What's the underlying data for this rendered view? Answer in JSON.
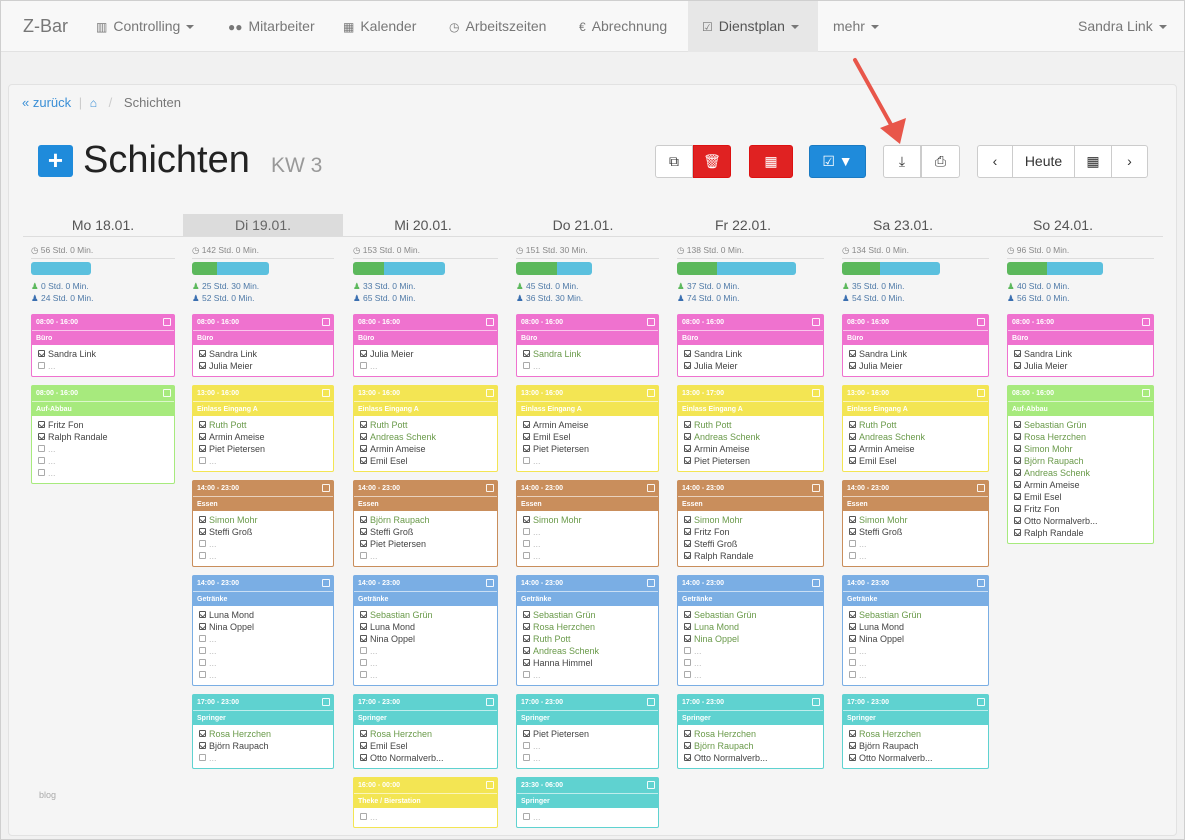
{
  "nav": {
    "brand": "Z-Bar",
    "items": [
      {
        "label": "Controlling",
        "icon": "bar-chart-icon"
      },
      {
        "label": "Mitarbeiter",
        "icon": "users-icon"
      },
      {
        "label": "Kalender",
        "icon": "calendar-icon"
      },
      {
        "label": "Arbeitszeiten",
        "icon": "clock-icon"
      },
      {
        "label": "Abrechnung",
        "icon": "euro-icon"
      },
      {
        "label": "Dienstplan",
        "icon": "calendar-check-icon"
      },
      {
        "label": "mehr",
        "icon": ""
      }
    ],
    "user": "Sandra Link"
  },
  "breadcrumb": {
    "back": "« zurück",
    "current": "Schichten"
  },
  "page": {
    "title": "Schichten",
    "week": "KW 3"
  },
  "toolbar": {
    "today": "Heute"
  },
  "footer": {
    "text": "blog"
  },
  "days": [
    {
      "label": "Mo 18.01.",
      "total": "56 Std. 0 Min.",
      "a": "0 Std. 0 Min.",
      "b": "24 Std. 0 Min.",
      "green": 0,
      "blue": 62,
      "cards": [
        {
          "time": "08:00 - 16:00",
          "name": "Büro",
          "color": "#ef72cf",
          "rows": [
            {
              "n": "Sandra Link",
              "c": 1
            },
            {
              "n": "...",
              "c": 0
            }
          ]
        },
        {
          "time": "08:00 - 16:00",
          "name": "Auf-Abbau",
          "color": "#a7ea7d",
          "rows": [
            {
              "n": "Fritz Fon",
              "c": 1
            },
            {
              "n": "Ralph Randale",
              "c": 1
            },
            {
              "n": "...",
              "c": 0
            },
            {
              "n": "...",
              "c": 0
            },
            {
              "n": "...",
              "c": 0
            }
          ]
        }
      ]
    },
    {
      "label": "Di 19.01.",
      "total": "142 Std. 0 Min.",
      "a": "25 Std. 30 Min.",
      "b": "52 Std. 0 Min.",
      "green": 26,
      "blue": 54,
      "cards": [
        {
          "time": "08:00 - 16:00",
          "name": "Büro",
          "color": "#ef72cf",
          "rows": [
            {
              "n": "Sandra Link",
              "c": 1
            },
            {
              "n": "Julia Meier",
              "c": 1
            }
          ]
        },
        {
          "time": "13:00 - 16:00",
          "name": "Einlass Eingang A",
          "color": "#f3e553",
          "rows": [
            {
              "n": "Ruth Pott",
              "c": 1,
              "g": 1
            },
            {
              "n": "Armin Ameise",
              "c": 1
            },
            {
              "n": "Piet Pietersen",
              "c": 1
            },
            {
              "n": "...",
              "c": 0
            }
          ]
        },
        {
          "time": "14:00 - 23:00",
          "name": "Essen",
          "color": "#c98e5c",
          "rows": [
            {
              "n": "Simon Mohr",
              "c": 1,
              "g": 1
            },
            {
              "n": "Steffi Groß",
              "c": 1
            },
            {
              "n": "...",
              "c": 0
            },
            {
              "n": "...",
              "c": 0
            }
          ]
        },
        {
          "time": "14:00 - 23:00",
          "name": "Getränke",
          "color": "#7aaee4",
          "rows": [
            {
              "n": "Luna Mond",
              "c": 1
            },
            {
              "n": "Nina Oppel",
              "c": 1
            },
            {
              "n": "...",
              "c": 0
            },
            {
              "n": "...",
              "c": 0
            },
            {
              "n": "...",
              "c": 0
            },
            {
              "n": "...",
              "c": 0
            }
          ]
        },
        {
          "time": "17:00 - 23:00",
          "name": "Springer",
          "color": "#5fd2d0",
          "rows": [
            {
              "n": "Rosa Herzchen",
              "c": 1,
              "g": 1
            },
            {
              "n": "Björn Raupach",
              "c": 1
            },
            {
              "n": "...",
              "c": 0
            }
          ]
        }
      ]
    },
    {
      "label": "Mi 20.01.",
      "total": "153 Std. 0 Min.",
      "a": "33 Std. 0 Min.",
      "b": "65 Std. 0 Min.",
      "green": 32,
      "blue": 62,
      "cards": [
        {
          "time": "08:00 - 16:00",
          "name": "Büro",
          "color": "#ef72cf",
          "rows": [
            {
              "n": "Julia Meier",
              "c": 1
            },
            {
              "n": "...",
              "c": 0
            }
          ]
        },
        {
          "time": "13:00 - 16:00",
          "name": "Einlass Eingang A",
          "color": "#f3e553",
          "rows": [
            {
              "n": "Ruth Pott",
              "c": 1,
              "g": 1
            },
            {
              "n": "Andreas Schenk",
              "c": 1,
              "g": 1
            },
            {
              "n": "Armin Ameise",
              "c": 1
            },
            {
              "n": "Emil Esel",
              "c": 1
            }
          ]
        },
        {
          "time": "14:00 - 23:00",
          "name": "Essen",
          "color": "#c98e5c",
          "rows": [
            {
              "n": "Björn Raupach",
              "c": 1,
              "g": 1
            },
            {
              "n": "Steffi Groß",
              "c": 1
            },
            {
              "n": "Piet Pietersen",
              "c": 1
            },
            {
              "n": "...",
              "c": 0
            }
          ]
        },
        {
          "time": "14:00 - 23:00",
          "name": "Getränke",
          "color": "#7aaee4",
          "rows": [
            {
              "n": "Sebastian Grün",
              "c": 1,
              "g": 1
            },
            {
              "n": "Luna Mond",
              "c": 1
            },
            {
              "n": "Nina Oppel",
              "c": 1
            },
            {
              "n": "...",
              "c": 0
            },
            {
              "n": "...",
              "c": 0
            },
            {
              "n": "...",
              "c": 0
            }
          ]
        },
        {
          "time": "17:00 - 23:00",
          "name": "Springer",
          "color": "#5fd2d0",
          "rows": [
            {
              "n": "Rosa Herzchen",
              "c": 1,
              "g": 1
            },
            {
              "n": "Emil Esel",
              "c": 1
            },
            {
              "n": "Otto Normalverb...",
              "c": 1
            }
          ]
        },
        {
          "time": "16:00 - 00:00",
          "name": "Theke / Bierstation",
          "color": "#f3e553",
          "rows": [
            {
              "n": "...",
              "c": 0
            }
          ]
        }
      ]
    },
    {
      "label": "Do 21.01.",
      "total": "151 Std. 30 Min.",
      "a": "45 Std. 0 Min.",
      "b": "36 Std. 30 Min.",
      "green": 42,
      "blue": 36,
      "cards": [
        {
          "time": "08:00 - 16:00",
          "name": "Büro",
          "color": "#ef72cf",
          "rows": [
            {
              "n": "Sandra Link",
              "c": 1,
              "g": 1
            },
            {
              "n": "...",
              "c": 0
            }
          ]
        },
        {
          "time": "13:00 - 16:00",
          "name": "Einlass Eingang A",
          "color": "#f3e553",
          "rows": [
            {
              "n": "Armin Ameise",
              "c": 1
            },
            {
              "n": "Emil Esel",
              "c": 1
            },
            {
              "n": "Piet Pietersen",
              "c": 1
            },
            {
              "n": "...",
              "c": 0
            }
          ]
        },
        {
          "time": "14:00 - 23:00",
          "name": "Essen",
          "color": "#c98e5c",
          "rows": [
            {
              "n": "Simon Mohr",
              "c": 1,
              "g": 1
            },
            {
              "n": "...",
              "c": 0
            },
            {
              "n": "...",
              "c": 0
            },
            {
              "n": "...",
              "c": 0
            }
          ]
        },
        {
          "time": "14:00 - 23:00",
          "name": "Getränke",
          "color": "#7aaee4",
          "rows": [
            {
              "n": "Sebastian Grün",
              "c": 1,
              "g": 1
            },
            {
              "n": "Rosa Herzchen",
              "c": 1,
              "g": 1
            },
            {
              "n": "Ruth Pott",
              "c": 1,
              "g": 1
            },
            {
              "n": "Andreas Schenk",
              "c": 1,
              "g": 1
            },
            {
              "n": "Hanna Himmel",
              "c": 1
            },
            {
              "n": "...",
              "c": 0
            }
          ]
        },
        {
          "time": "17:00 - 23:00",
          "name": "Springer",
          "color": "#5fd2d0",
          "rows": [
            {
              "n": "Piet Pietersen",
              "c": 1
            },
            {
              "n": "...",
              "c": 0
            },
            {
              "n": "...",
              "c": 0
            }
          ]
        },
        {
          "time": "23:30 - 06:00",
          "name": "Springer",
          "color": "#5fd2d0",
          "rows": [
            {
              "n": "...",
              "c": 0
            }
          ]
        }
      ]
    },
    {
      "label": "Fr 22.01.",
      "total": "138 Std. 0 Min.",
      "a": "37 Std. 0 Min.",
      "b": "74 Std. 0 Min.",
      "green": 40,
      "blue": 80,
      "cards": [
        {
          "time": "08:00 - 16:00",
          "name": "Büro",
          "color": "#ef72cf",
          "rows": [
            {
              "n": "Sandra Link",
              "c": 1
            },
            {
              "n": "Julia Meier",
              "c": 1
            }
          ]
        },
        {
          "time": "13:00 - 17:00",
          "name": "Einlass Eingang A",
          "color": "#f3e553",
          "rows": [
            {
              "n": "Ruth Pott",
              "c": 1,
              "g": 1
            },
            {
              "n": "Andreas Schenk",
              "c": 1,
              "g": 1
            },
            {
              "n": "Armin Ameise",
              "c": 1
            },
            {
              "n": "Piet Pietersen",
              "c": 1
            }
          ]
        },
        {
          "time": "14:00 - 23:00",
          "name": "Essen",
          "color": "#c98e5c",
          "rows": [
            {
              "n": "Simon Mohr",
              "c": 1,
              "g": 1
            },
            {
              "n": "Fritz Fon",
              "c": 1
            },
            {
              "n": "Steffi Groß",
              "c": 1
            },
            {
              "n": "Ralph Randale",
              "c": 1
            }
          ]
        },
        {
          "time": "14:00 - 23:00",
          "name": "Getränke",
          "color": "#7aaee4",
          "rows": [
            {
              "n": "Sebastian Grün",
              "c": 1,
              "g": 1
            },
            {
              "n": "Luna Mond",
              "c": 1,
              "g": 1
            },
            {
              "n": "Nina Oppel",
              "c": 1,
              "g": 1
            },
            {
              "n": "...",
              "c": 0
            },
            {
              "n": "...",
              "c": 0
            },
            {
              "n": "...",
              "c": 0
            }
          ]
        },
        {
          "time": "17:00 - 23:00",
          "name": "Springer",
          "color": "#5fd2d0",
          "rows": [
            {
              "n": "Rosa Herzchen",
              "c": 1,
              "g": 1
            },
            {
              "n": "Björn Raupach",
              "c": 1,
              "g": 1
            },
            {
              "n": "Otto Normalverb...",
              "c": 1
            }
          ]
        }
      ]
    },
    {
      "label": "Sa 23.01.",
      "total": "134 Std. 0 Min.",
      "a": "35 Std. 0 Min.",
      "b": "54 Std. 0 Min.",
      "green": 38,
      "blue": 60,
      "cards": [
        {
          "time": "08:00 - 16:00",
          "name": "Büro",
          "color": "#ef72cf",
          "rows": [
            {
              "n": "Sandra Link",
              "c": 1
            },
            {
              "n": "Julia Meier",
              "c": 1
            }
          ]
        },
        {
          "time": "13:00 - 16:00",
          "name": "Einlass Eingang A",
          "color": "#f3e553",
          "rows": [
            {
              "n": "Ruth Pott",
              "c": 1,
              "g": 1
            },
            {
              "n": "Andreas Schenk",
              "c": 1,
              "g": 1
            },
            {
              "n": "Armin Ameise",
              "c": 1
            },
            {
              "n": "Emil Esel",
              "c": 1
            }
          ]
        },
        {
          "time": "14:00 - 23:00",
          "name": "Essen",
          "color": "#c98e5c",
          "rows": [
            {
              "n": "Simon Mohr",
              "c": 1,
              "g": 1
            },
            {
              "n": "Steffi Groß",
              "c": 1
            },
            {
              "n": "...",
              "c": 0
            },
            {
              "n": "...",
              "c": 0
            }
          ]
        },
        {
          "time": "14:00 - 23:00",
          "name": "Getränke",
          "color": "#7aaee4",
          "rows": [
            {
              "n": "Sebastian Grün",
              "c": 1,
              "g": 1
            },
            {
              "n": "Luna Mond",
              "c": 1
            },
            {
              "n": "Nina Oppel",
              "c": 1
            },
            {
              "n": "...",
              "c": 0
            },
            {
              "n": "...",
              "c": 0
            },
            {
              "n": "...",
              "c": 0
            }
          ]
        },
        {
          "time": "17:00 - 23:00",
          "name": "Springer",
          "color": "#5fd2d0",
          "rows": [
            {
              "n": "Rosa Herzchen",
              "c": 1,
              "g": 1
            },
            {
              "n": "Björn Raupach",
              "c": 1
            },
            {
              "n": "Otto Normalverb...",
              "c": 1
            }
          ]
        }
      ]
    },
    {
      "label": "So 24.01.",
      "total": "96 Std. 0 Min.",
      "a": "40 Std. 0 Min.",
      "b": "56 Std. 0 Min.",
      "green": 40,
      "blue": 56,
      "cards": [
        {
          "time": "08:00 - 16:00",
          "name": "Büro",
          "color": "#ef72cf",
          "rows": [
            {
              "n": "Sandra Link",
              "c": 1
            },
            {
              "n": "Julia Meier",
              "c": 1
            }
          ]
        },
        {
          "time": "08:00 - 16:00",
          "name": "Auf-Abbau",
          "color": "#a7ea7d",
          "rows": [
            {
              "n": "Sebastian Grün",
              "c": 1,
              "g": 1
            },
            {
              "n": "Rosa Herzchen",
              "c": 1,
              "g": 1
            },
            {
              "n": "Simon Mohr",
              "c": 1,
              "g": 1
            },
            {
              "n": "Björn Raupach",
              "c": 1,
              "g": 1
            },
            {
              "n": "Andreas Schenk",
              "c": 1,
              "g": 1
            },
            {
              "n": "Armin Ameise",
              "c": 1
            },
            {
              "n": "Emil Esel",
              "c": 1
            },
            {
              "n": "Fritz Fon",
              "c": 1
            },
            {
              "n": "Otto Normalverb...",
              "c": 1
            },
            {
              "n": "Ralph Randale",
              "c": 1
            }
          ]
        }
      ]
    }
  ]
}
